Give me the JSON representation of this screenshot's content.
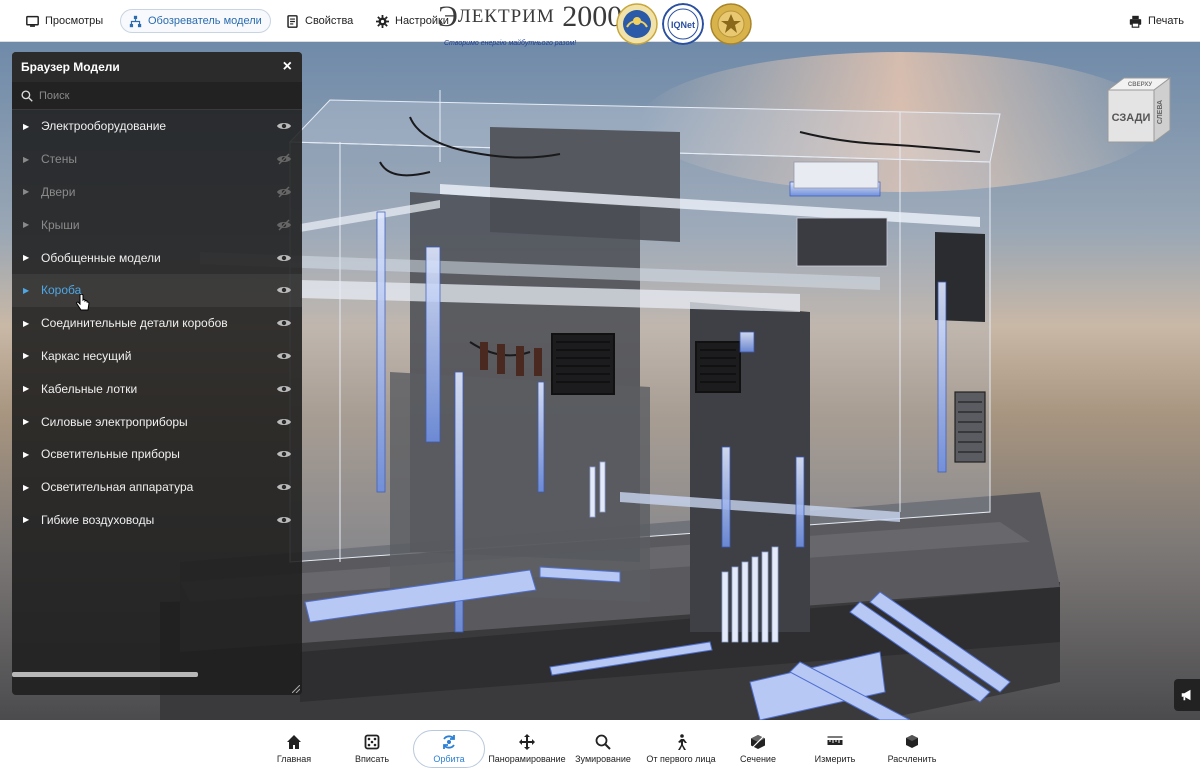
{
  "topbar": {
    "tabs": [
      {
        "label": "Просмотры",
        "icon": "monitor-icon"
      },
      {
        "label": "Обозреватель модели",
        "icon": "hierarchy-icon",
        "active": true
      },
      {
        "label": "Свойства",
        "icon": "document-icon"
      },
      {
        "label": "Настройки",
        "icon": "gear-icon"
      }
    ],
    "print_label": "Печать"
  },
  "logo": {
    "title_first": "Э",
    "title_rest": "ЛЕКТРИМ",
    "title_year": "2000",
    "slogan": "Створимо енергію майбутнього разом!",
    "seal_text": "IQNet"
  },
  "viewcube": {
    "front": "СЗАДИ",
    "side": "СЛЕВА",
    "top": "СВЕРХУ"
  },
  "panel": {
    "title": "Браузер Модели",
    "close": "×",
    "search_placeholder": "Поиск",
    "items": [
      {
        "label": "Электрооборудование",
        "visible": true
      },
      {
        "label": "Стены",
        "visible": false
      },
      {
        "label": "Двери",
        "visible": false
      },
      {
        "label": "Крыши",
        "visible": false
      },
      {
        "label": "Обобщенные модели",
        "visible": true
      },
      {
        "label": "Короба",
        "visible": true,
        "selected": true
      },
      {
        "label": "Соединительные детали коробов",
        "visible": true
      },
      {
        "label": "Каркас несущий",
        "visible": true
      },
      {
        "label": "Кабельные лотки",
        "visible": true
      },
      {
        "label": "Силовые электроприборы",
        "visible": true
      },
      {
        "label": "Осветительные приборы",
        "visible": true
      },
      {
        "label": "Осветительная аппаратура",
        "visible": true
      },
      {
        "label": "Гибкие воздуховоды",
        "visible": true
      }
    ]
  },
  "toolbar": {
    "tools": [
      {
        "label": "Главная",
        "icon": "home-icon"
      },
      {
        "label": "Вписать",
        "icon": "fit-icon"
      },
      {
        "label": "Орбита",
        "icon": "orbit-icon",
        "active": true
      },
      {
        "label": "Панорамирование",
        "icon": "pan-icon"
      },
      {
        "label": "Зумирование",
        "icon": "zoom-icon"
      },
      {
        "label": "От первого лица",
        "icon": "walk-icon"
      },
      {
        "label": "Сечение",
        "icon": "section-icon"
      },
      {
        "label": "Измерить",
        "icon": "ruler-icon"
      },
      {
        "label": "Расчленить",
        "icon": "explode-icon"
      }
    ]
  },
  "colors": {
    "accent": "#2b80d6",
    "selected_item": "#4ea7e6",
    "panel_bg": "#1e1e1e"
  }
}
